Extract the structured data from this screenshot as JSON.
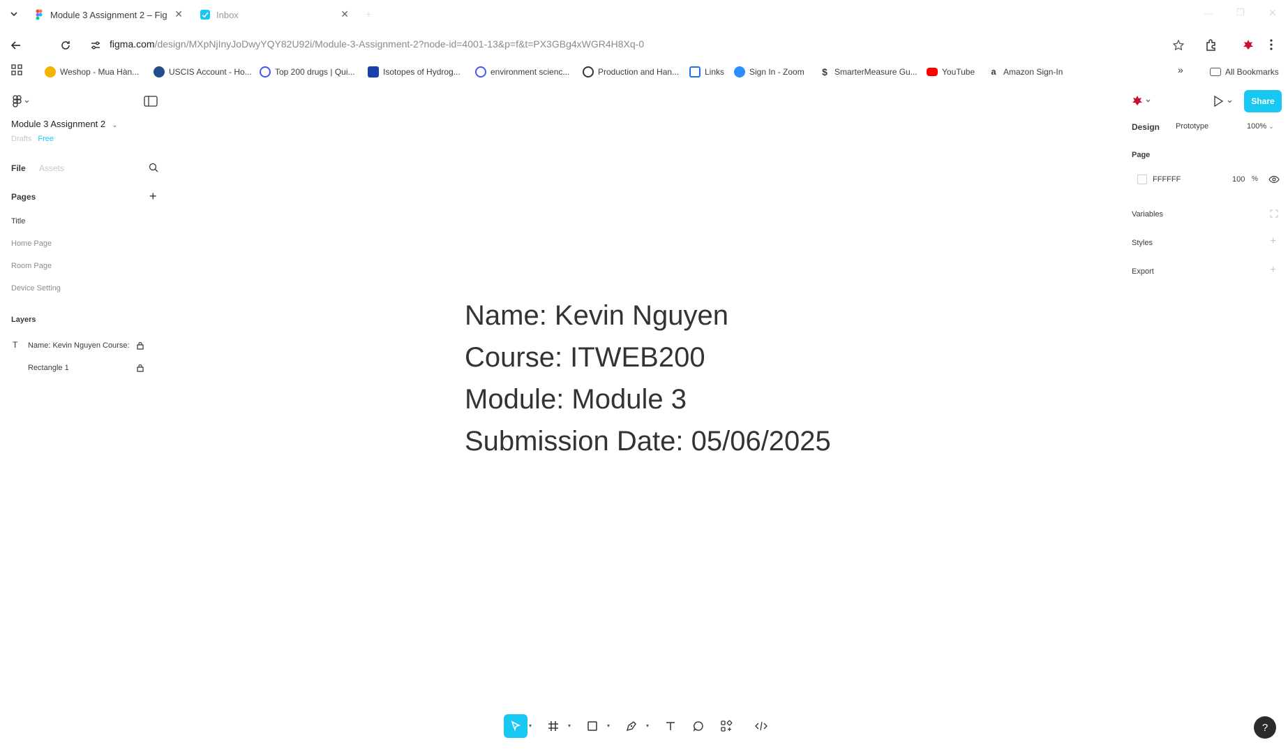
{
  "browser": {
    "tabs": [
      {
        "label": "Module 3 Assignment 2 – Fig",
        "active": true
      },
      {
        "label": "Inbox",
        "active": false
      }
    ],
    "url": {
      "host": "figma.com",
      "path": "/design/MXpNjInyJoDwyYQY82U92i/Module-3-Assignment-2?node-id=4001-13&p=f&t=PX3GBg4xWGR4H8Xq-0"
    },
    "bookmarks": [
      {
        "label": "Weshop - Mua Hàn...",
        "icon": "weshop-icon",
        "color": "#f4b400"
      },
      {
        "label": "USCIS Account - Ho...",
        "icon": "uscis-icon",
        "color": "#1f4e8c"
      },
      {
        "label": "Top 200 drugs | Qui...",
        "icon": "quizlet-icon",
        "color": "#4255ff"
      },
      {
        "label": "Isotopes of Hydrog...",
        "icon": "shield-star-icon",
        "color": "#1c3faa"
      },
      {
        "label": "environment scienc...",
        "icon": "quizlet-icon",
        "color": "#4255ff"
      },
      {
        "label": "Production and Han...",
        "icon": "globe-icon",
        "color": "#333333"
      },
      {
        "label": "Links",
        "icon": "eye-icon",
        "color": "#1a73e8"
      },
      {
        "label": "Sign In - Zoom",
        "icon": "zoom-icon",
        "color": "#2d8cff"
      },
      {
        "label": "SmarterMeasure Gu...",
        "icon": "s-icon",
        "color": "#000000"
      },
      {
        "label": "YouTube",
        "icon": "youtube-icon",
        "color": "#ff0000"
      },
      {
        "label": "Amazon Sign-In",
        "icon": "amazon-icon",
        "color": "#000000"
      }
    ],
    "all_bookmarks": "All Bookmarks"
  },
  "figma": {
    "file_name": "Module 3 Assignment 2",
    "plan": {
      "drafts": "Drafts",
      "tier": "Free"
    },
    "tabs": {
      "file": "File",
      "assets": "Assets"
    },
    "pages_heading": "Pages",
    "pages": [
      "Title",
      "Home Page",
      "Room Page",
      "Device Setting"
    ],
    "layers_heading": "Layers",
    "layers": [
      {
        "label": "Name: Kevin Nguyen Course:",
        "type": "text"
      },
      {
        "label": "Rectangle 1",
        "type": "rectangle"
      }
    ],
    "canvas_lines": [
      "Name: Kevin Nguyen",
      "Course: ITWEB200",
      "Module: Module 3",
      "Submission Date: 05/06/2025"
    ],
    "right_panel": {
      "share_label": "Share",
      "tabs": {
        "design": "Design",
        "prototype": "Prototype"
      },
      "zoom": "100%",
      "page_heading": "Page",
      "page_color": "FFFFFF",
      "page_opacity": "100",
      "variables": "Variables",
      "styles": "Styles",
      "export": "Export"
    },
    "help_label": "?",
    "accent_color": "#18c8f2"
  }
}
